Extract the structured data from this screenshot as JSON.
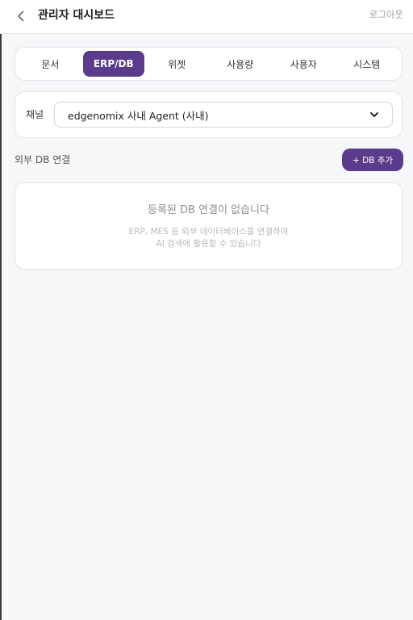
{
  "header": {
    "back_icon": "chevron-left-icon",
    "title": "관리자 대시보드",
    "logout_label": "로그아웃"
  },
  "tabs": [
    {
      "label": "문서",
      "active": false
    },
    {
      "label": "ERP/DB",
      "active": true
    },
    {
      "label": "위젯",
      "active": false
    },
    {
      "label": "사용량",
      "active": false
    },
    {
      "label": "사용자",
      "active": false
    },
    {
      "label": "시스템",
      "active": false
    }
  ],
  "channel": {
    "label": "채널",
    "selected": "edgenomix 사내 Agent (사내)"
  },
  "db_section": {
    "title": "외부 DB 연결",
    "add_button": "+ DB 추가",
    "empty_title": "등록된 DB 연결이 없습니다",
    "empty_desc_line1": "ERP, MES 등 외부 데이터베이스를 연결하여",
    "empty_desc_line2": "AI 검색에 활용할 수 있습니다"
  },
  "colors": {
    "accent": "#5b3c8c",
    "background": "#f6f7f9",
    "card": "#ffffff"
  }
}
